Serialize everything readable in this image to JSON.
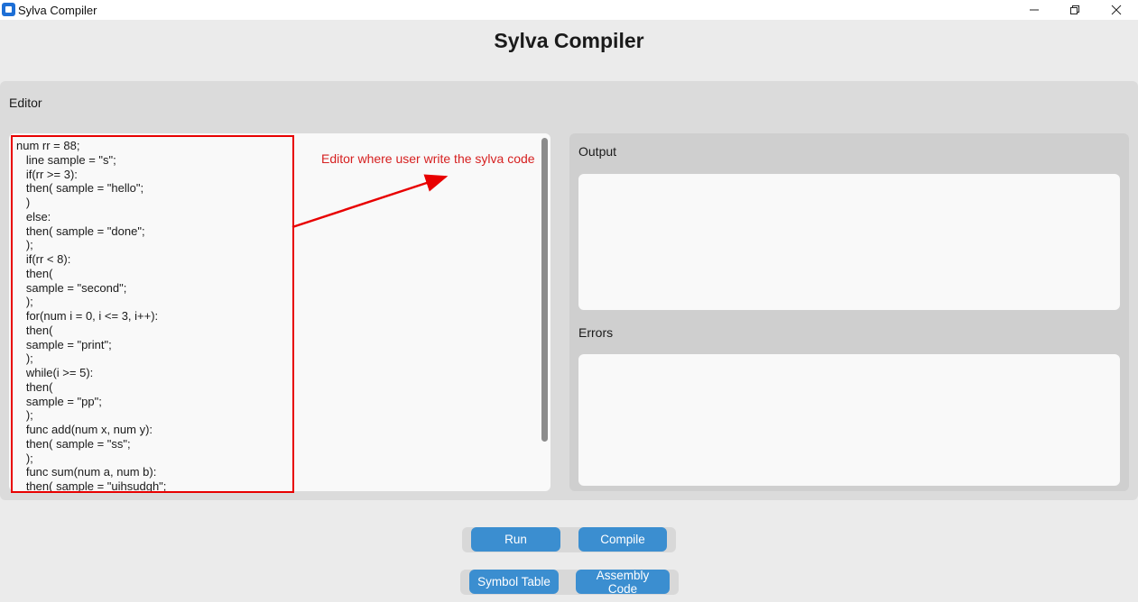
{
  "window": {
    "title": "Sylva Compiler"
  },
  "header": {
    "title": "Sylva Compiler"
  },
  "editor": {
    "label": "Editor",
    "code": "num rr = 88;\n   line sample = \"s\";\n   if(rr >= 3):\n   then( sample = \"hello\";\n   )\n   else:\n   then( sample = \"done\";\n   );\n   if(rr < 8):\n   then(\n   sample = \"second\";\n   );\n   for(num i = 0, i <= 3, i++):\n   then(\n   sample = \"print\";\n   );\n   while(i >= 5):\n   then(\n   sample = \"pp\";\n   );\n   func add(num x, num y):\n   then( sample = \"ss\";\n   );\n   func sum(num a, num b):\n   then( sample = \"uihsudgh\";"
  },
  "annotation": {
    "text": "Editor where user write the sylva code",
    "color": "#d62020"
  },
  "output": {
    "label": "Output"
  },
  "errors": {
    "label": "Errors"
  },
  "buttons": {
    "run": "Run",
    "compile": "Compile",
    "symbol_table": "Symbol Table",
    "assembly_code": "Assembly Code"
  },
  "colors": {
    "accent": "#3b8ed0",
    "highlight": "#e80000"
  }
}
